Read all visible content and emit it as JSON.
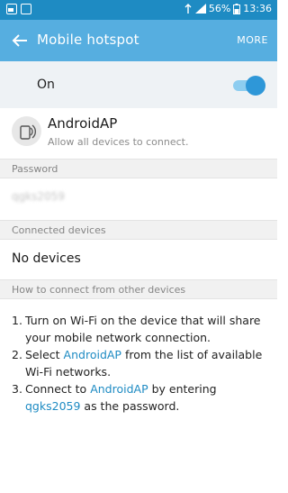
{
  "status_bar": {
    "battery_percent": "56%",
    "time": "13:36"
  },
  "app_bar": {
    "title": "Mobile hotspot",
    "more_label": "MORE"
  },
  "hotspot_toggle": {
    "label": "On",
    "enabled": true
  },
  "network": {
    "name": "AndroidAP",
    "description": "Allow all devices to connect."
  },
  "password_section": {
    "header": "Password",
    "value": "qgks2059"
  },
  "devices_section": {
    "header": "Connected devices",
    "empty_text": "No devices"
  },
  "howto_section": {
    "header": "How to connect from other devices",
    "steps": [
      {
        "num": "1.",
        "text": "Turn on Wi-Fi on the device that will share your mobile network connection."
      },
      {
        "num": "2.",
        "pre": "Select ",
        "highlight": "AndroidAP",
        "post": " from the list of available Wi-Fi networks."
      },
      {
        "num": "3.",
        "pre": "Connect to ",
        "highlight": "AndroidAP",
        "mid": " by entering ",
        "highlight2": "qgks2059",
        "post": " as the password."
      }
    ]
  },
  "colors": {
    "status_bar": "#1e8bc3",
    "app_bar": "#56aee0",
    "accent": "#2e97d8",
    "highlight_text": "#1e8bc3"
  }
}
